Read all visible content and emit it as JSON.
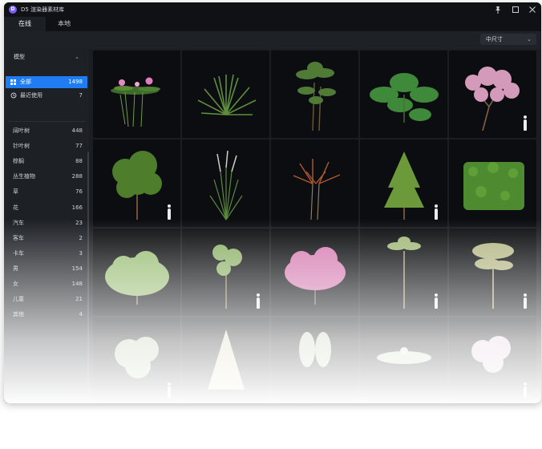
{
  "app": {
    "title": "D5 渲染器素材库",
    "logo": "D"
  },
  "window_controls": {
    "pin_icon": "pin-icon",
    "maximize_icon": "maximize-icon",
    "close_icon": "close-icon"
  },
  "tabs": [
    {
      "label": "在线",
      "active": true
    },
    {
      "label": "本地",
      "active": false
    }
  ],
  "toolbar": {
    "size_select": "中尺寸"
  },
  "sidebar": {
    "type_select": "模型",
    "nav": [
      {
        "label": "全部",
        "count": "1498",
        "icon": "grid-icon",
        "active": true
      },
      {
        "label": "最近使用",
        "count": "7",
        "icon": "history-icon",
        "active": false
      }
    ],
    "categories": [
      {
        "label": "阔叶树",
        "count": "448"
      },
      {
        "label": "针叶树",
        "count": "77"
      },
      {
        "label": "棕榈",
        "count": "88"
      },
      {
        "label": "丛生植物",
        "count": "288"
      },
      {
        "label": "草",
        "count": "76"
      },
      {
        "label": "花",
        "count": "166"
      },
      {
        "label": "汽车",
        "count": "23"
      },
      {
        "label": "客车",
        "count": "2"
      },
      {
        "label": "卡车",
        "count": "3"
      },
      {
        "label": "男",
        "count": "154"
      },
      {
        "label": "女",
        "count": "148"
      },
      {
        "label": "儿童",
        "count": "21"
      },
      {
        "label": "其他",
        "count": "4"
      }
    ]
  },
  "assets": [
    {
      "name": "water-lily",
      "scale_figure": false
    },
    {
      "name": "agave-grass",
      "scale_figure": false
    },
    {
      "name": "palm-plant",
      "scale_figure": false
    },
    {
      "name": "monstera",
      "scale_figure": false
    },
    {
      "name": "pink-blossom-tree",
      "scale_figure": true
    },
    {
      "name": "broadleaf-tree",
      "scale_figure": true
    },
    {
      "name": "ornamental-grass",
      "scale_figure": false
    },
    {
      "name": "red-cordyline",
      "scale_figure": false
    },
    {
      "name": "conifer-tree",
      "scale_figure": true
    },
    {
      "name": "hedge",
      "scale_figure": false
    },
    {
      "name": "round-shrub",
      "scale_figure": false
    },
    {
      "name": "young-tree",
      "scale_figure": true
    },
    {
      "name": "pink-flower-shrub",
      "scale_figure": false
    },
    {
      "name": "tall-palm",
      "scale_figure": true
    },
    {
      "name": "flat-top-tree",
      "scale_figure": true
    },
    {
      "name": "faded-tree-1",
      "scale_figure": true
    },
    {
      "name": "faded-pine",
      "scale_figure": false
    },
    {
      "name": "faded-plant",
      "scale_figure": false
    },
    {
      "name": "faded-lily",
      "scale_figure": false
    },
    {
      "name": "faded-blossom",
      "scale_figure": true
    }
  ],
  "colors": {
    "accent": "#1f7cf2",
    "window_bg": "#1a1d21",
    "tile_bg": "#0c0d10"
  }
}
